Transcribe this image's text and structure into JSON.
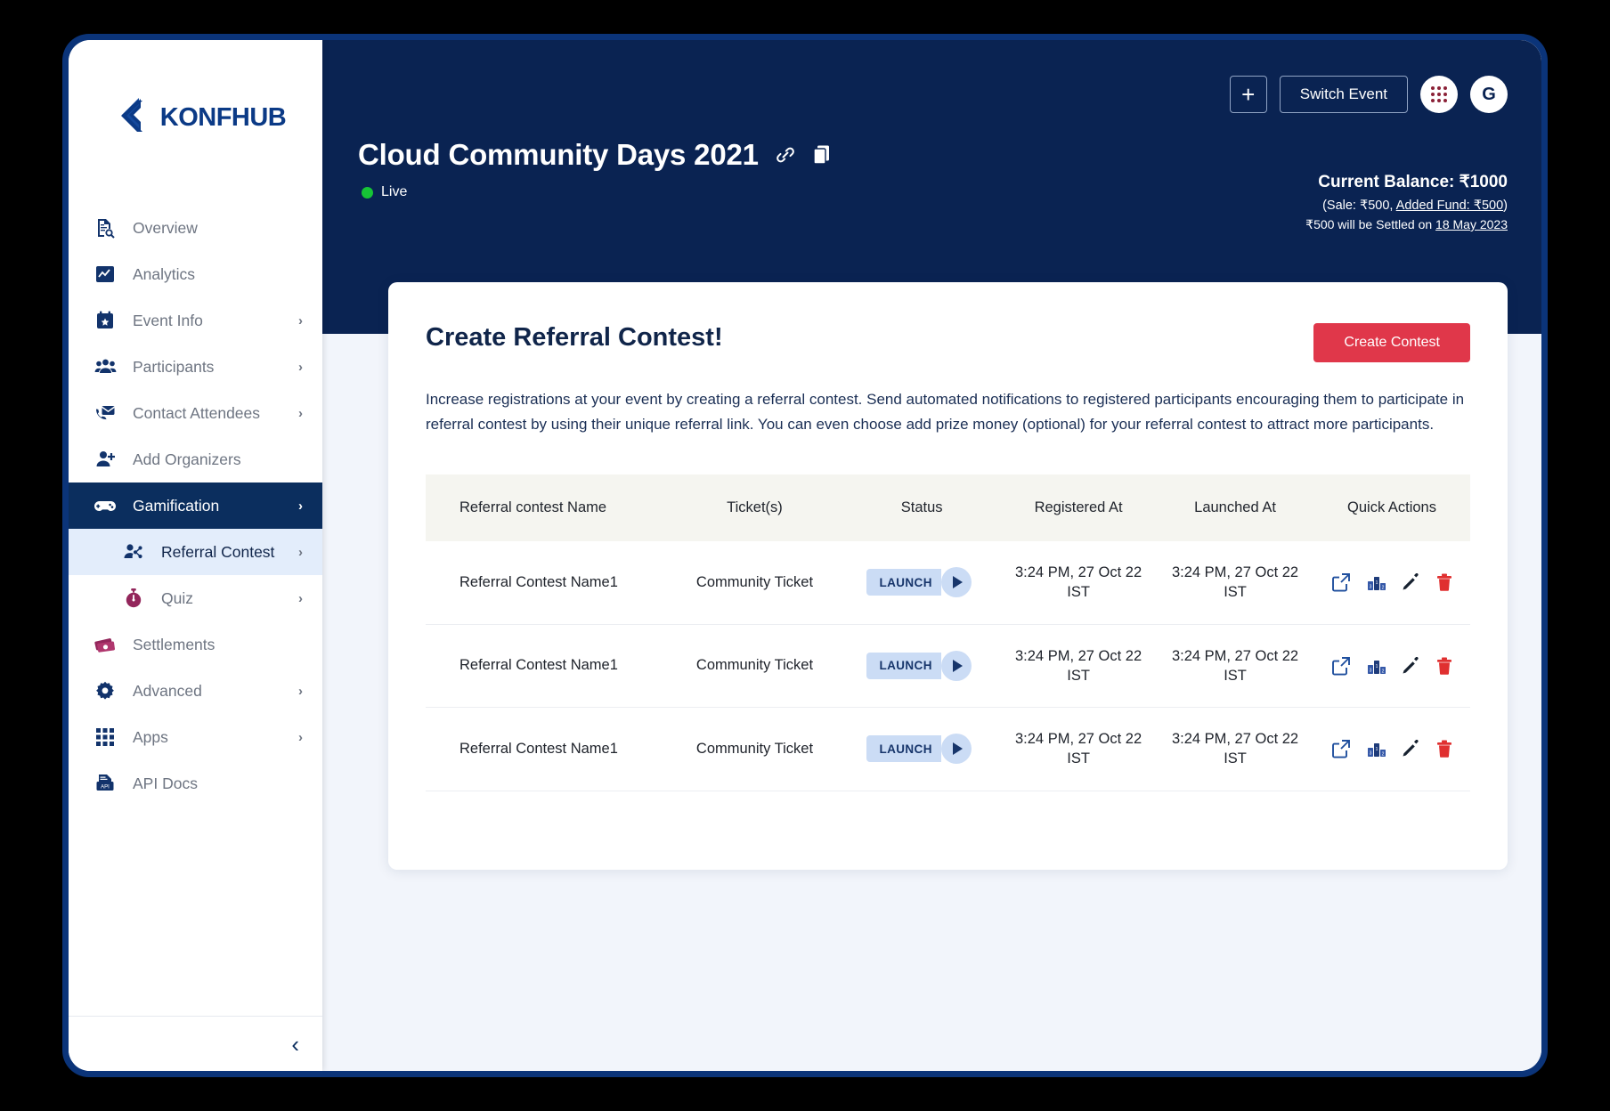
{
  "brand": {
    "name": "KONFHUB"
  },
  "sidebar": {
    "items": [
      {
        "label": "Overview",
        "icon": "document-search-icon",
        "chevron": false,
        "state": "normal"
      },
      {
        "label": "Analytics",
        "icon": "chart-icon",
        "chevron": false,
        "state": "normal"
      },
      {
        "label": "Event Info",
        "icon": "calendar-star-icon",
        "chevron": true,
        "state": "normal"
      },
      {
        "label": "Participants",
        "icon": "people-icon",
        "chevron": true,
        "state": "normal"
      },
      {
        "label": "Contact Attendees",
        "icon": "mail-phone-icon",
        "chevron": true,
        "state": "normal"
      },
      {
        "label": "Add Organizers",
        "icon": "user-plus-icon",
        "chevron": false,
        "state": "normal"
      },
      {
        "label": "Gamification",
        "icon": "gamepad-icon",
        "chevron": true,
        "state": "active"
      },
      {
        "label": "Referral Contest",
        "icon": "share-user-icon",
        "chevron": true,
        "state": "subactive"
      },
      {
        "label": "Quiz",
        "icon": "stopwatch-icon",
        "chevron": true,
        "state": "sub"
      },
      {
        "label": "Settlements",
        "icon": "money-icon",
        "chevron": false,
        "state": "normal"
      },
      {
        "label": "Advanced",
        "icon": "gear-icon",
        "chevron": true,
        "state": "normal"
      },
      {
        "label": "Apps",
        "icon": "grid-apps-icon",
        "chevron": true,
        "state": "normal"
      },
      {
        "label": "API Docs",
        "icon": "api-doc-icon",
        "chevron": false,
        "state": "normal"
      }
    ],
    "collapse_label": "‹"
  },
  "topbar": {
    "add_button": "+",
    "switch_event_label": "Switch Event",
    "apps_icon": "grid-apps-icon",
    "avatar_initial": "G",
    "event_title": "Cloud Community Days 2021",
    "link_icon": "link-icon",
    "copy_icon": "copy-icon",
    "status_label": "Live",
    "status_color": "#16c436"
  },
  "balance": {
    "current": "Current Balance: ₹1000",
    "breakdown_prefix": "(Sale: ₹500, ",
    "breakdown_link": "Added Fund: ₹500",
    "breakdown_suffix": ")",
    "settle_prefix": "₹500 will be Settled on ",
    "settle_date": "18 May 2023"
  },
  "content": {
    "title": "Create Referral Contest!",
    "create_button": "Create Contest",
    "description": "Increase registrations at your event by creating a referral contest. Send automated notifications to registered participants encouraging them to participate in referral contest by using their unique referral link. You can even choose add prize money (optional) for your referral contest to attract more participants."
  },
  "table": {
    "headers": [
      "Referral contest Name",
      "Ticket(s)",
      "Status",
      "Registered At",
      "Launched At",
      "Quick Actions"
    ],
    "rows": [
      {
        "name": "Referral Contest Name1",
        "ticket": "Community Ticket",
        "status": "LAUNCH",
        "registered_at": "3:24 PM, 27 Oct 22 IST",
        "launched_at": "3:24 PM, 27 Oct 22 IST",
        "actions": [
          "external-link-icon",
          "leaderboard-icon",
          "edit-pencil-icon",
          "delete-trash-icon"
        ]
      },
      {
        "name": "Referral Contest Name1",
        "ticket": "Community Ticket",
        "status": "LAUNCH",
        "registered_at": "3:24 PM, 27 Oct 22 IST",
        "launched_at": "3:24 PM, 27 Oct 22 IST",
        "actions": [
          "external-link-icon",
          "leaderboard-icon",
          "edit-pencil-icon",
          "delete-trash-icon"
        ]
      },
      {
        "name": "Referral Contest Name1",
        "ticket": "Community Ticket",
        "status": "LAUNCH",
        "registered_at": "3:24 PM, 27 Oct 22 IST",
        "launched_at": "3:24 PM, 27 Oct 22 IST",
        "actions": [
          "external-link-icon",
          "leaderboard-icon",
          "edit-pencil-icon",
          "delete-trash-icon"
        ]
      }
    ]
  },
  "colors": {
    "frame": "#0b3479",
    "topbar": "#0a2352",
    "accent_red": "#e0374a",
    "sidebar_active": "#0b2e5e",
    "sidebar_subactive": "#e3edfb",
    "brand_blue": "#0b3a86"
  }
}
